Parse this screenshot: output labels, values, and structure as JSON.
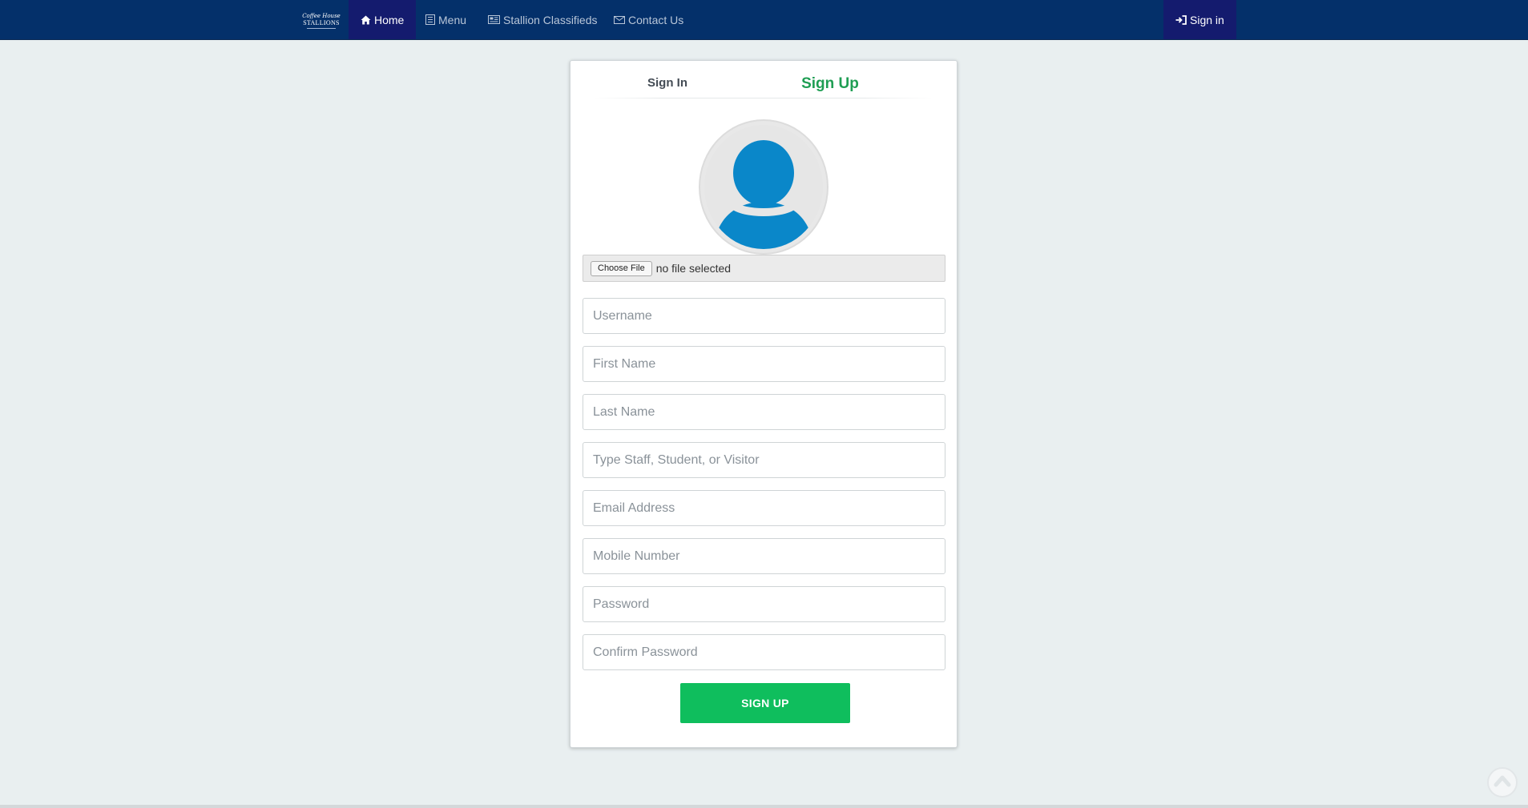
{
  "navbar": {
    "logo": {
      "script_text": "Coffee House",
      "main_text": "STALLIONS",
      "icon": "brand-logo"
    },
    "items": [
      {
        "label": "Home",
        "icon": "home-icon",
        "active": true
      },
      {
        "label": "Menu",
        "icon": "menu-book-icon",
        "active": false
      },
      {
        "label": "Stallion Classifieds",
        "icon": "newspaper-icon",
        "active": false
      },
      {
        "label": "Contact Us",
        "icon": "envelope-icon",
        "active": false
      }
    ],
    "signin": {
      "label": "Sign in",
      "icon": "sign-in-icon"
    }
  },
  "auth_card": {
    "tabs": [
      {
        "label": "Sign In",
        "active": false
      },
      {
        "label": "Sign Up",
        "active": true
      }
    ],
    "avatar_icon": "user-avatar-icon",
    "file_input": {
      "button_label": "Choose File",
      "status": "no file selected"
    },
    "fields": [
      {
        "name": "username",
        "placeholder": "Username"
      },
      {
        "name": "first_name",
        "placeholder": "First Name"
      },
      {
        "name": "last_name",
        "placeholder": "Last Name"
      },
      {
        "name": "type",
        "placeholder": "Type Staff, Student, or Visitor"
      },
      {
        "name": "email",
        "placeholder": "Email Address"
      },
      {
        "name": "mobile",
        "placeholder": "Mobile Number"
      },
      {
        "name": "password",
        "placeholder": "Password"
      },
      {
        "name": "confirm_password",
        "placeholder": "Confirm Password"
      }
    ],
    "submit_label": "SIGN UP"
  },
  "colors": {
    "navbar_bg": "#04306a",
    "nav_active_bg": "#141b6e",
    "page_bg": "#e9eff0",
    "accent_green": "#1f9e53",
    "button_green": "#0fbe5d",
    "avatar_blue": "#0a87c9"
  },
  "scroll_top_icon": "chevron-up-icon"
}
